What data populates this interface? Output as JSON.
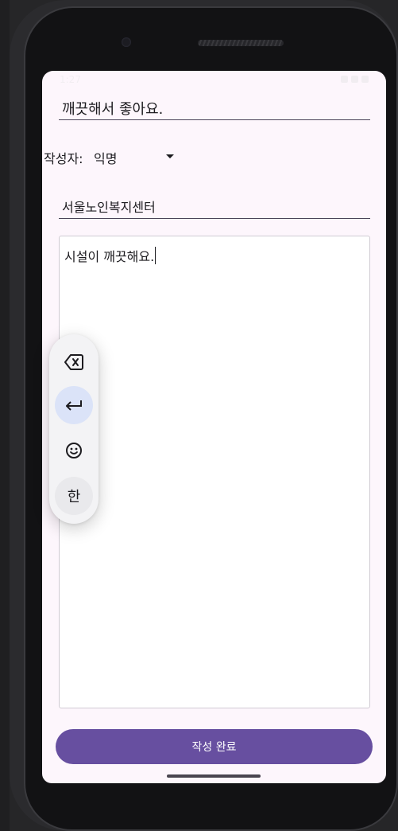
{
  "status_bar": {
    "time": "1:27"
  },
  "form": {
    "title_value": "깨끗해서 좋아요.",
    "author_label": "작성자:",
    "author_value": "익명",
    "center_value": "서울노인복지센터",
    "content_value": "시설이 깨끗해요.",
    "submit_label": "작성 완료"
  },
  "keyboard_toolbar": {
    "items": [
      {
        "name": "backspace-icon"
      },
      {
        "name": "enter-icon",
        "active": true
      },
      {
        "name": "emoji-icon"
      },
      {
        "name": "hangul-toggle",
        "label": "한"
      }
    ]
  },
  "colors": {
    "accent": "#674fa0",
    "screen_bg": "#fdf6fc",
    "active_key_bg": "#dbe3f8"
  }
}
